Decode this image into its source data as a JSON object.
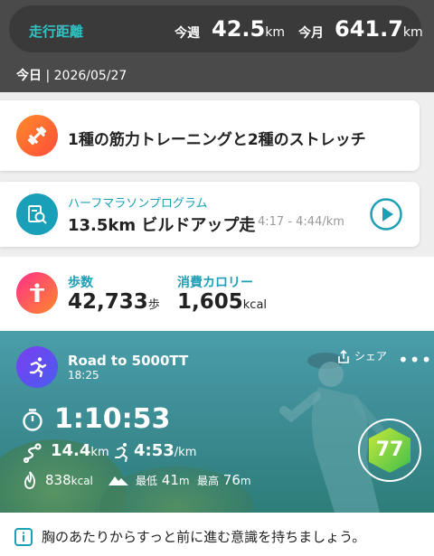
{
  "header": {
    "distance_label": "走行距離",
    "week_label": "今週",
    "week_value": "42.5",
    "week_unit": "km",
    "month_label": "今月",
    "month_value": "641.7",
    "month_unit": "km"
  },
  "date_bar": {
    "today": "今日",
    "date": "2026/05/27"
  },
  "workout": {
    "title": "1種の筋力トレーニングと2種のストレッチ",
    "icon": "dumbbell-icon",
    "color": "#ff6a2f"
  },
  "program": {
    "name": "ハーフマラソンプログラム",
    "title": "13.5km ビルドアップ走",
    "pace": "4:17 - 4:44/km",
    "icon": "analysis-icon",
    "accent": "#1d9fb6"
  },
  "daily": {
    "steps_label": "歩数",
    "steps_value": "42,733",
    "steps_unit": "歩",
    "calories_label": "消費カロリー",
    "calories_value": "1,605",
    "calories_unit": "kcal"
  },
  "activity": {
    "name": "Road to 5000TT",
    "time": "18:25",
    "share_label": "シェア",
    "duration": "1:10:53",
    "distance": "14.4",
    "distance_unit": "km",
    "pace": "4:53",
    "pace_unit": "/km",
    "calories": "838",
    "calories_unit": "kcal",
    "elev_min_label": "最低",
    "elev_min": "41",
    "elev_max_label": "最高",
    "elev_max": "76",
    "elev_unit": "m",
    "score": "77"
  },
  "tip": {
    "text": "胸のあたりからすっと前に進む意識を持ちましょう。"
  }
}
